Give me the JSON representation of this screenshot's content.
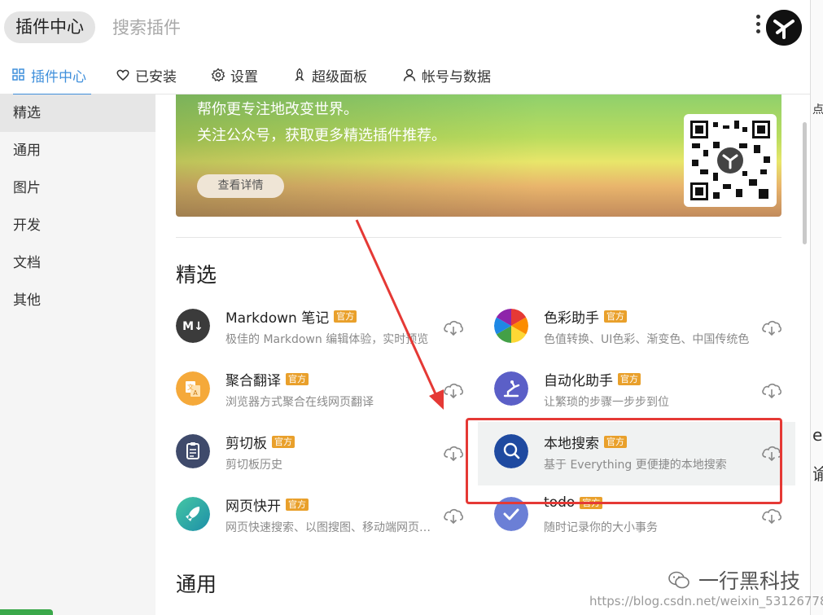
{
  "topbar": {
    "pill_label": "插件中心",
    "search_placeholder": "搜索插件"
  },
  "tabs": [
    {
      "label": "插件中心",
      "icon": "grid-icon",
      "active": true
    },
    {
      "label": "已安装",
      "icon": "heart-icon"
    },
    {
      "label": "设置",
      "icon": "gear-icon"
    },
    {
      "label": "超级面板",
      "icon": "rocket-icon"
    },
    {
      "label": "帐号与数据",
      "icon": "user-icon"
    }
  ],
  "sidebar": {
    "items": [
      {
        "label": "精选",
        "active": true
      },
      {
        "label": "通用"
      },
      {
        "label": "图片"
      },
      {
        "label": "开发"
      },
      {
        "label": "文档"
      },
      {
        "label": "其他"
      }
    ]
  },
  "banner": {
    "line1": "帮你更专注地改变世界。",
    "line2": "关注公众号，获取更多精选插件推荐。",
    "button": "查看详情"
  },
  "sections": {
    "featured": "精选",
    "general": "通用"
  },
  "plugins": [
    {
      "name": "Markdown 笔记",
      "badge": "官方",
      "desc": "极佳的 Markdown 编辑体验，实时预览",
      "icon": "markdown-icon",
      "color": "#3b3b3b"
    },
    {
      "name": "色彩助手",
      "badge": "官方",
      "desc": "色值转换、UI色彩、渐变色、中国传统色",
      "icon": "color-wheel-icon",
      "color": "#e53935"
    },
    {
      "name": "聚合翻译",
      "badge": "官方",
      "desc": "浏览器方式聚合在线网页翻译",
      "icon": "translate-icon",
      "color": "#f5a93a"
    },
    {
      "name": "自动化助手",
      "badge": "官方",
      "desc": "让繁琐的步骤一步步到位",
      "icon": "robot-arm-icon",
      "color": "#5b5fc7"
    },
    {
      "name": "剪切板",
      "badge": "官方",
      "desc": "剪切板历史",
      "icon": "clipboard-icon",
      "color": "#3f4a6b"
    },
    {
      "name": "本地搜索",
      "badge": "官方",
      "desc": "基于 Everything 更便捷的本地搜索",
      "icon": "search-icon",
      "color": "#1f4aa0"
    },
    {
      "name": "网页快开",
      "badge": "官方",
      "desc": "网页快速搜索、以图搜图、移动端网页预览",
      "icon": "rocket-icon",
      "color": "#2bb3a2"
    },
    {
      "name": "todo",
      "badge": "官方",
      "desc": "随时记录你的大小事务",
      "icon": "check-icon",
      "color": "#6b7fd6"
    }
  ],
  "watermark": {
    "wechat": "一行黑科技",
    "url": "https://blog.csdn.net/weixin_53126778"
  },
  "right_strip": {
    "chars": [
      "点",
      "e",
      "谕"
    ]
  },
  "colors": {
    "accent": "#3f8fdb",
    "badge": "#e9a02b",
    "highlight_box": "#e53935"
  }
}
